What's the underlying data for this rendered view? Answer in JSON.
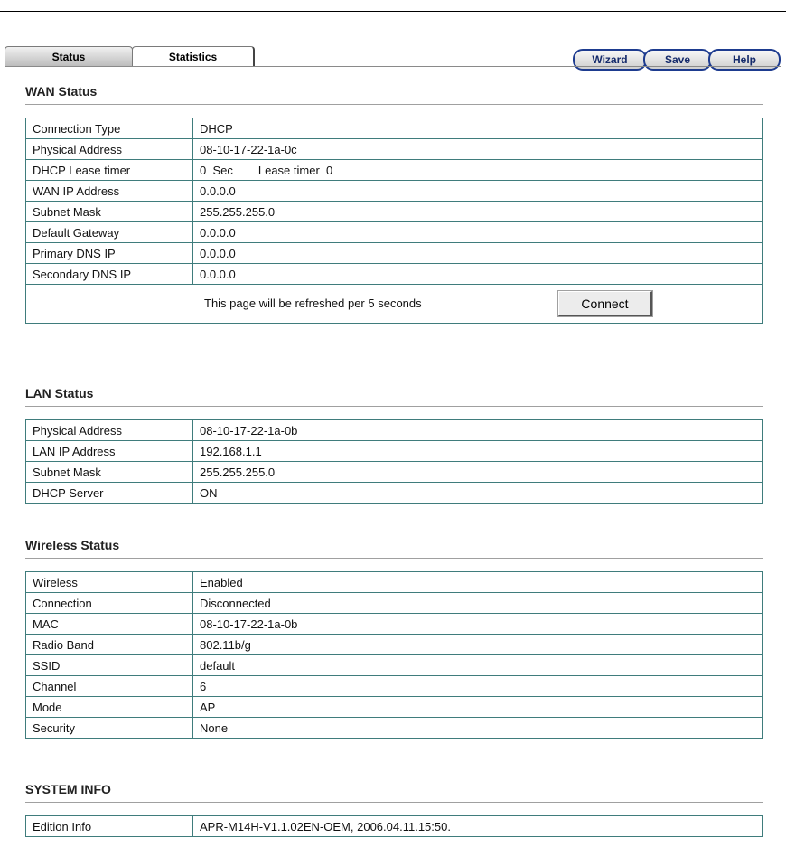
{
  "tabs": [
    {
      "label": "Status"
    },
    {
      "label": "Statistics"
    }
  ],
  "buttons": {
    "wizard": "Wizard",
    "save": "Save",
    "help": "Help",
    "connect": "Connect"
  },
  "wan": {
    "title": "WAN Status",
    "rows": [
      {
        "label": "Connection Type",
        "value": "DHCP"
      },
      {
        "label": "Physical Address",
        "value": "08-10-17-22-1a-0c"
      },
      {
        "label": "DHCP Lease timer",
        "value": "0  Sec",
        "extra": "Lease timer  0"
      },
      {
        "label": "WAN IP Address",
        "value": "0.0.0.0"
      },
      {
        "label": "Subnet Mask",
        "value": "255.255.255.0"
      },
      {
        "label": "Default Gateway",
        "value": "0.0.0.0"
      },
      {
        "label": "Primary DNS IP",
        "value": "0.0.0.0"
      },
      {
        "label": "Secondary DNS IP",
        "value": "0.0.0.0"
      }
    ],
    "refresh_text": "This page will be refreshed per 5 seconds"
  },
  "lan": {
    "title": "LAN Status",
    "rows": [
      {
        "label": "Physical Address",
        "value": "08-10-17-22-1a-0b"
      },
      {
        "label": "LAN IP Address",
        "value": "192.168.1.1"
      },
      {
        "label": "Subnet Mask",
        "value": "255.255.255.0"
      },
      {
        "label": "DHCP Server",
        "value": "ON"
      }
    ]
  },
  "wireless": {
    "title": "Wireless Status",
    "rows": [
      {
        "label": "Wireless",
        "value": "Enabled"
      },
      {
        "label": "Connection",
        "value": "Disconnected"
      },
      {
        "label": "MAC",
        "value": "08-10-17-22-1a-0b"
      },
      {
        "label": "Radio Band",
        "value": "802.11b/g"
      },
      {
        "label": "SSID",
        "value": "default"
      },
      {
        "label": "Channel",
        "value": "6"
      },
      {
        "label": "Mode",
        "value": "AP"
      },
      {
        "label": "Security",
        "value": "None"
      }
    ]
  },
  "system": {
    "title": "SYSTEM INFO",
    "rows": [
      {
        "label": "Edition Info",
        "value": "APR-M14H-V1.1.02EN-OEM, 2006.04.11.15:50."
      }
    ]
  }
}
